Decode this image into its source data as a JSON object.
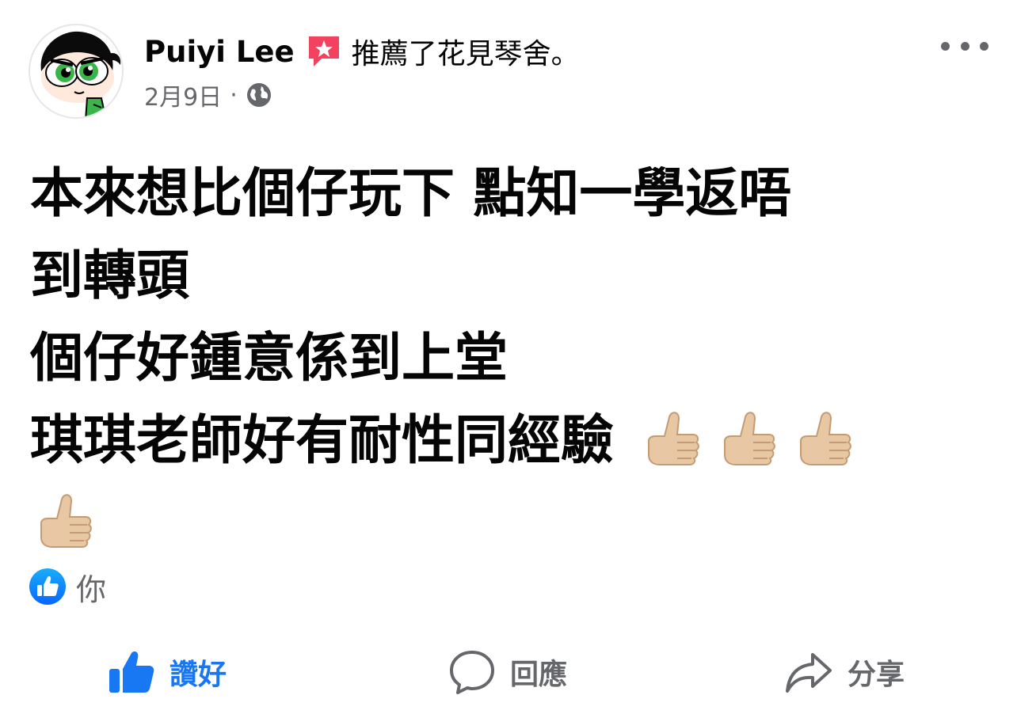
{
  "post": {
    "author": "Puiyi Lee",
    "action": "推薦了花見琴舍。",
    "date": "2月9日",
    "separator": "·",
    "privacy_icon": "globe-icon",
    "body_lines": [
      "本來想比個仔玩下 點知一學返唔",
      "到轉頭",
      "個仔好鍾意係到上堂",
      "琪琪老師好有耐性同經驗"
    ],
    "emoji": "thumbs-up-light-skin-tone",
    "emoji_count": 4
  },
  "reactions": {
    "icon": "like-icon",
    "names": "你"
  },
  "actions": {
    "like": "讚好",
    "comment": "回應",
    "share": "分享"
  },
  "colors": {
    "accent": "#1877f2",
    "text": "#050505",
    "secondary": "#65676b",
    "recommend_badge": "#f3425f"
  }
}
